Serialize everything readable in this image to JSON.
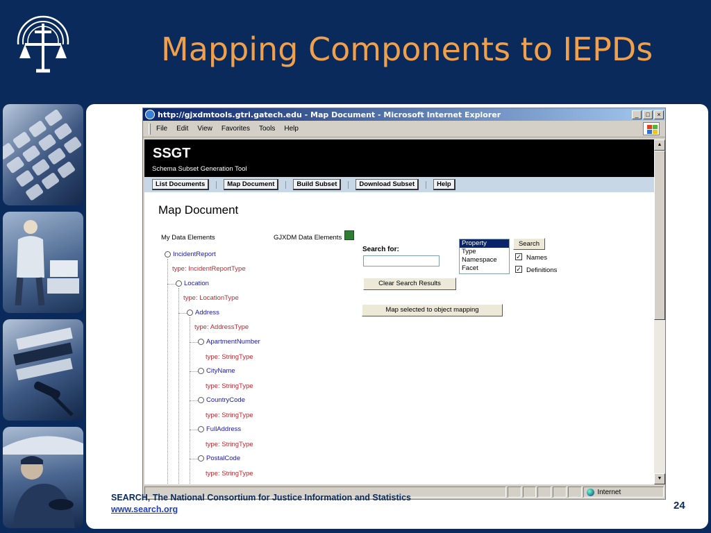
{
  "slide": {
    "title": "Mapping Components to IEPDs",
    "footer_org": "SEARCH, The National Consortium for Justice Information and Statistics",
    "footer_url": "www.search.org",
    "page_number": "24"
  },
  "browser": {
    "title": "http://gjxdmtools.gtri.gatech.edu - Map Document - Microsoft Internet Explorer",
    "menu": [
      "File",
      "Edit",
      "View",
      "Favorites",
      "Tools",
      "Help"
    ],
    "window_buttons": [
      "_",
      "□",
      "×"
    ],
    "status_zone": "Internet"
  },
  "app": {
    "name": "SSGT",
    "subtitle": "Schema Subset Generation Tool",
    "nav": [
      "List Documents",
      "Map Document",
      "Build Subset",
      "Download Subset",
      "Help"
    ],
    "page_heading": "Map Document",
    "my_data_label": "My Data Elements",
    "gjxdm_label": "GJXDM Data Elements",
    "search_label": "Search for:",
    "search_value": "",
    "search_button": "Search",
    "list_options": [
      "Property",
      "Type",
      "Namespace",
      "Facet"
    ],
    "list_selected": "Property",
    "checkbox_names": "Names",
    "checkbox_names_checked": true,
    "checkbox_definitions": "Definitions",
    "checkbox_definitions_checked": true,
    "clear_button": "Clear Search Results",
    "map_button": "Map selected to object mapping"
  },
  "tree": [
    {
      "name": "IncidentReport",
      "type": "type: IncidentReportType",
      "depth": 0
    },
    {
      "name": "Location",
      "type": "type: LocationType",
      "depth": 1
    },
    {
      "name": "Address",
      "type": "type: AddressType",
      "depth": 2
    },
    {
      "name": "ApartmentNumber",
      "type": "type: StringType",
      "depth": 3
    },
    {
      "name": "CityName",
      "type": "type: StringType",
      "depth": 3
    },
    {
      "name": "CountryCode",
      "type": "type: StringType",
      "depth": 3
    },
    {
      "name": "FullAddress",
      "type": "type: StringType",
      "depth": 3
    },
    {
      "name": "PostalCode",
      "type": "type: StringType",
      "depth": 3
    }
  ],
  "colors": {
    "slide_background": "#0b2a5c",
    "title_orange": "#f0a04b",
    "link_blue": "#1a1aa8",
    "type_red": "#c0282f",
    "nav_bar": "#c7d7e6"
  }
}
